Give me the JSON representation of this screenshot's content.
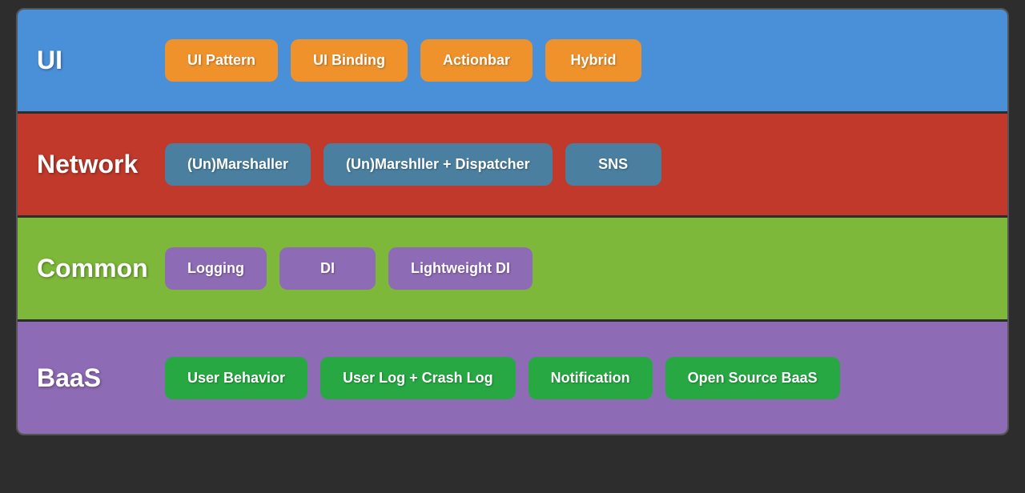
{
  "layers": [
    {
      "id": "ui",
      "label": "UI",
      "colorClass": "layer-ui",
      "items": [
        {
          "id": "ui-pattern",
          "label": "UI Pattern"
        },
        {
          "id": "ui-binding",
          "label": "UI Binding"
        },
        {
          "id": "actionbar",
          "label": "Actionbar"
        },
        {
          "id": "hybrid",
          "label": "Hybrid"
        }
      ]
    },
    {
      "id": "network",
      "label": "Network",
      "colorClass": "layer-network",
      "items": [
        {
          "id": "unmarshaller",
          "label": "(Un)Marshaller"
        },
        {
          "id": "unmarshller-dispatcher",
          "label": "(Un)Marshller + Dispatcher"
        },
        {
          "id": "sns",
          "label": "SNS"
        }
      ]
    },
    {
      "id": "common",
      "label": "Common",
      "colorClass": "layer-common",
      "items": [
        {
          "id": "logging",
          "label": "Logging"
        },
        {
          "id": "di",
          "label": "DI"
        },
        {
          "id": "lightweight-di",
          "label": "Lightweight DI"
        }
      ]
    },
    {
      "id": "baas",
      "label": "BaaS",
      "colorClass": "layer-baas",
      "items": [
        {
          "id": "user-behavior",
          "label": "User Behavior"
        },
        {
          "id": "user-crash-log",
          "label": "User Log +\nCrash Log"
        },
        {
          "id": "notification",
          "label": "Notification"
        },
        {
          "id": "open-source-baas",
          "label": "Open Source BaaS"
        }
      ]
    }
  ]
}
